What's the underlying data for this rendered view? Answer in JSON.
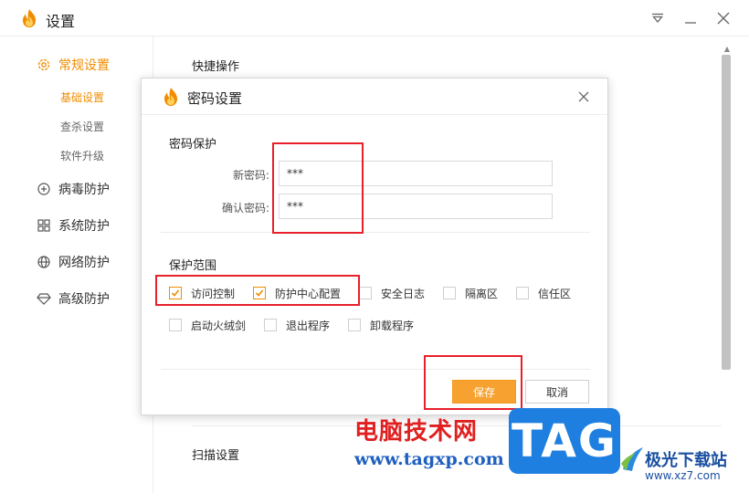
{
  "window": {
    "title": "设置",
    "controls": [
      "menu-icon",
      "minimize-icon",
      "close-icon"
    ]
  },
  "sidebar": {
    "items": [
      {
        "label": "常规设置",
        "icon": "gear-icon",
        "active": true
      },
      {
        "label": "病毒防护",
        "icon": "plus-circle-icon"
      },
      {
        "label": "系统防护",
        "icon": "grid-icon"
      },
      {
        "label": "网络防护",
        "icon": "globe-icon"
      },
      {
        "label": "高级防护",
        "icon": "diamond-icon"
      }
    ],
    "subitems": [
      {
        "label": "基础设置",
        "active": true
      },
      {
        "label": "查杀设置"
      },
      {
        "label": "软件升级"
      }
    ]
  },
  "content": {
    "section_top": "快捷操作",
    "section_bottom": "扫描设置"
  },
  "dialog": {
    "title": "密码设置",
    "password_group": "密码保护",
    "new_password_label": "新密码:",
    "new_password_value": "***",
    "confirm_password_label": "确认密码:",
    "confirm_password_value": "***",
    "scope_group": "保护范围",
    "scope_options": [
      {
        "label": "访问控制",
        "checked": true
      },
      {
        "label": "防护中心配置",
        "checked": true
      },
      {
        "label": "安全日志",
        "checked": false
      },
      {
        "label": "隔离区",
        "checked": false
      },
      {
        "label": "信任区",
        "checked": false
      },
      {
        "label": "启动火绒剑",
        "checked": false
      },
      {
        "label": "退出程序",
        "checked": false
      },
      {
        "label": "卸载程序",
        "checked": false
      }
    ],
    "save_label": "保存",
    "cancel_label": "取消"
  },
  "watermark": {
    "cn_title": "电脑技术网",
    "url": "www.tagxp.com",
    "badge": "TAG",
    "site_name": "极光下载站",
    "site_url": "www.xz7.com"
  },
  "colors": {
    "accent": "#f08c00",
    "save_button": "#f7a230",
    "highlight_box": "#e8202a",
    "badge_blue": "#1e7fe0"
  }
}
